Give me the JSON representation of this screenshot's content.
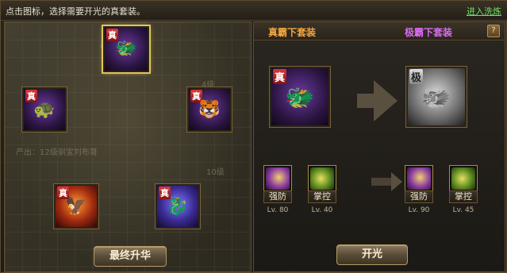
{
  "topbar": {
    "instruction": "点击图标，选择需要开光的真套装。",
    "enter_link": "进入洗炼"
  },
  "left_panel": {
    "map_labels": [
      "产出",
      "产出：12级驯宝刘布哥",
      "4级",
      "10级"
    ],
    "beasts": [
      {
        "badge": "真",
        "glyph": "🐲",
        "selected": true
      },
      {
        "badge": "真",
        "glyph": "🐢",
        "selected": false
      },
      {
        "badge": "真",
        "glyph": "🐯",
        "selected": false
      },
      {
        "badge": "真",
        "glyph": "🦅",
        "selected": false
      },
      {
        "badge": "真",
        "glyph": "🐉",
        "selected": false
      }
    ],
    "final_button": "最终升华"
  },
  "right_panel": {
    "current_suit": "真霸下套装",
    "target_suit": "极霸下套装",
    "help": "?",
    "current_icon_badge": "真",
    "target_icon_badge": "极",
    "current_glyph": "🐲",
    "target_glyph": "🐲",
    "skills_before": [
      {
        "label": "强防",
        "level": "Lv. 80",
        "type": "def"
      },
      {
        "label": "掌控",
        "level": "Lv. 40",
        "type": "ctl"
      }
    ],
    "skills_after": [
      {
        "label": "强防",
        "level": "Lv. 90",
        "type": "def"
      },
      {
        "label": "掌控",
        "level": "Lv. 45",
        "type": "ctl"
      }
    ],
    "open_button": "开光"
  },
  "colors": {
    "accent_gold": "#f2a640",
    "accent_purple": "#d86cf0",
    "link_green": "#6fe06a"
  }
}
